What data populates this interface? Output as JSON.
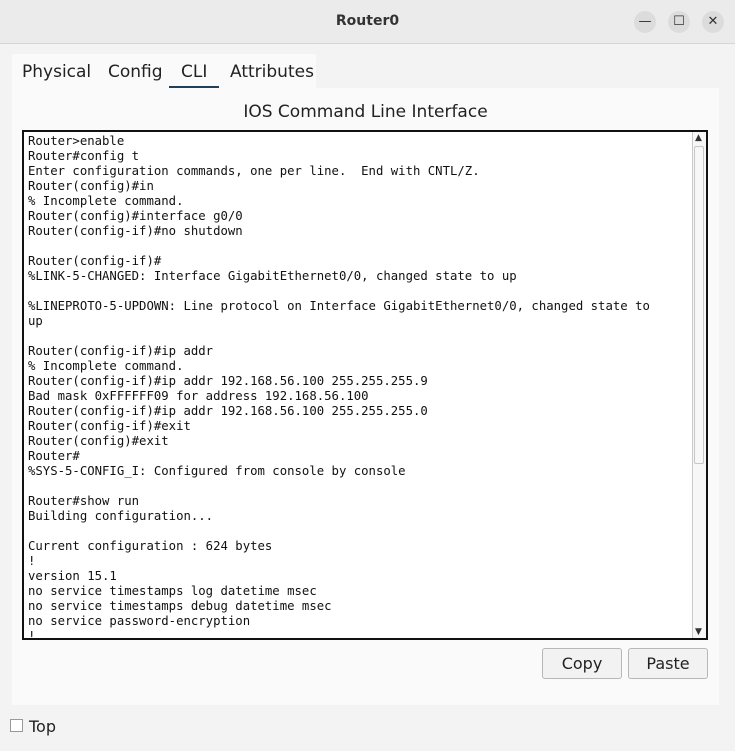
{
  "window": {
    "title": "Router0"
  },
  "window_controls": {
    "minimize_glyph": "—",
    "maximize_glyph": "☐",
    "close_glyph": "✕"
  },
  "tabs": [
    {
      "label": "Physical"
    },
    {
      "label": "Config"
    },
    {
      "label": "CLI"
    },
    {
      "label": "Attributes"
    }
  ],
  "active_tab": "CLI",
  "panel": {
    "title": "IOS Command Line Interface"
  },
  "console": {
    "lines": [
      "Router>enable",
      "Router#config t",
      "Enter configuration commands, one per line.  End with CNTL/Z.",
      "Router(config)#in",
      "% Incomplete command.",
      "Router(config)#interface g0/0",
      "Router(config-if)#no shutdown",
      "",
      "Router(config-if)#",
      "%LINK-5-CHANGED: Interface GigabitEthernet0/0, changed state to up",
      "",
      "%LINEPROTO-5-UPDOWN: Line protocol on Interface GigabitEthernet0/0, changed state to",
      "up",
      "",
      "Router(config-if)#ip addr",
      "% Incomplete command.",
      "Router(config-if)#ip addr 192.168.56.100 255.255.255.9",
      "Bad mask 0xFFFFFF09 for address 192.168.56.100",
      "Router(config-if)#ip addr 192.168.56.100 255.255.255.0",
      "Router(config-if)#exit",
      "Router(config)#exit",
      "Router#",
      "%SYS-5-CONFIG_I: Configured from console by console",
      "",
      "Router#show run",
      "Building configuration...",
      "",
      "Current configuration : 624 bytes",
      "!",
      "version 15.1",
      "no service timestamps log datetime msec",
      "no service timestamps debug datetime msec",
      "no service password-encryption",
      "!"
    ]
  },
  "buttons": {
    "copy": "Copy",
    "paste": "Paste"
  },
  "bottom": {
    "top_label": "Top"
  },
  "colors": {
    "tab_underline": "#1f3f5a"
  }
}
